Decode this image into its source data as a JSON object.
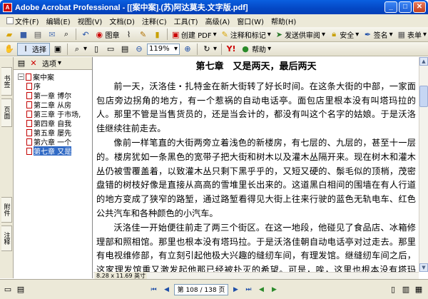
{
  "window": {
    "title": "Adobe Acrobat Professional - [[案中案].(苏)阿达莫夫.文字版.pdf]",
    "app_icon_text": "A"
  },
  "menu": [
    "文件(F)",
    "编辑(E)",
    "视图(V)",
    "文档(D)",
    "注释(C)",
    "工具(T)",
    "高级(A)",
    "窗口(W)",
    "帮助(H)"
  ],
  "toolbar1": {
    "stamp_label": "图章",
    "create_pdf_label": "创建 PDF",
    "comment_label": "注释和标记",
    "send_review_label": "发送供审阅",
    "security_label": "安全",
    "sign_label": "签名",
    "forms_label": "表单"
  },
  "toolbar2": {
    "select_label": "选择",
    "zoom_value": "119%",
    "help_label": "帮助"
  },
  "side_tabs": [
    "书签",
    "页面",
    "附件",
    "注释"
  ],
  "bookmarks": {
    "options_label": "选项",
    "root": "案中案",
    "items": [
      "序",
      "第一章 博尔",
      "第二章 从房",
      "第三章 于市场,",
      "第四章 自我",
      "第五章 屡先",
      "第六章 一个",
      "第七章 又是"
    ]
  },
  "document": {
    "chapter_title": "第七章　又是两天，最后两天",
    "paragraphs": [
      "前一天，沃洛佳・扎特金在新大街转了好长时间。在这条大街的中部，一家面包店旁边拐角的地方，有一个惹祸的自动电话亭。面包店里根本没有叫塔玛拉的人。那里不管是当售货员的，还是当会计的，都没有叫这个名字的姑娘。于是沃洛佳继续往前走去。",
      "像前一样笔直的大街两旁立着浅色的新楼房，有七层的、九层的，甚至十一层的。楼房犹如一条黑色的宽带子把大街和树木以及灌木丛隔开来。现在树木和灌木丛仍被雪覆盖着，以致灌木丛只剩下黑乎乎的，又短又硬的、鬃毛似的顶梢，茂密盘错的树枝好像是直接从高高的雪堆里长出来的。这道黑白相间的围墙在有人行道的地方变成了狭窄的路堑，通过路堑看得见大街上往来行驶的蓝色无轨电车、红色公共汽车和各种颜色的小汽车。",
      "沃洛佳一开始便往前走了两三个街区。在这一地段，他碰见了食品店、冰箱修理部和照相馆。那里也根本没有塔玛拉。于是沃洛佳朝自动电话亭对过走去。那里有电视维修部，有立刻引起他极大兴趣的缝纫车间，有理发馆。继缝纫车间之后，这家理发馆重又激发起他那已经被扑灭的希望。可是，唉，这里也根本没有塔玛拉。确切点说，他在理发馆找到一个塔玛拉，长得非常好看，人又机灵活泼。沃洛佳来了情绪，兴致勃勃地谈起来，以致使姑娘羞红了脸。"
    ]
  },
  "page_size": "8.28 x 11.69 英寸",
  "navigation": {
    "page_label": "第 108 / 138 页"
  }
}
